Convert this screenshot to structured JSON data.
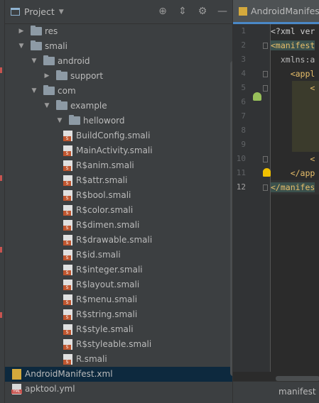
{
  "project_panel": {
    "title": "Project",
    "header_icons": [
      "crosshair-icon",
      "collapse-icon",
      "gear-icon",
      "minimize-icon"
    ],
    "tree": [
      {
        "label": "res",
        "type": "folder",
        "depth": 1,
        "expanded": false
      },
      {
        "label": "smali",
        "type": "folder",
        "depth": 1,
        "expanded": true
      },
      {
        "label": "android",
        "type": "folder",
        "depth": 2,
        "expanded": true
      },
      {
        "label": "support",
        "type": "folder",
        "depth": 3,
        "expanded": false
      },
      {
        "label": "com",
        "type": "folder",
        "depth": 2,
        "expanded": true
      },
      {
        "label": "example",
        "type": "folder",
        "depth": 3,
        "expanded": true
      },
      {
        "label": "helloword",
        "type": "folder",
        "depth": 4,
        "expanded": true
      },
      {
        "label": "BuildConfig.smali",
        "type": "smali",
        "depth": 5
      },
      {
        "label": "MainActivity.smali",
        "type": "smali",
        "depth": 5
      },
      {
        "label": "R$anim.smali",
        "type": "smali",
        "depth": 5
      },
      {
        "label": "R$attr.smali",
        "type": "smali",
        "depth": 5
      },
      {
        "label": "R$bool.smali",
        "type": "smali",
        "depth": 5
      },
      {
        "label": "R$color.smali",
        "type": "smali",
        "depth": 5
      },
      {
        "label": "R$dimen.smali",
        "type": "smali",
        "depth": 5
      },
      {
        "label": "R$drawable.smali",
        "type": "smali",
        "depth": 5
      },
      {
        "label": "R$id.smali",
        "type": "smali",
        "depth": 5
      },
      {
        "label": "R$integer.smali",
        "type": "smali",
        "depth": 5
      },
      {
        "label": "R$layout.smali",
        "type": "smali",
        "depth": 5
      },
      {
        "label": "R$menu.smali",
        "type": "smali",
        "depth": 5
      },
      {
        "label": "R$string.smali",
        "type": "smali",
        "depth": 5
      },
      {
        "label": "R$style.smali",
        "type": "smali",
        "depth": 5
      },
      {
        "label": "R$styleable.smali",
        "type": "smali",
        "depth": 5
      },
      {
        "label": "R.smali",
        "type": "smali",
        "depth": 5
      },
      {
        "label": "AndroidManifest.xml",
        "type": "xml",
        "depth": 1,
        "selected": true
      },
      {
        "label": "apktool.yml",
        "type": "yml",
        "depth": 1
      }
    ]
  },
  "editor": {
    "tab_label": "AndroidManifest.xml",
    "line_numbers": [
      "1",
      "2",
      "3",
      "4",
      "5",
      "6",
      "7",
      "8",
      "9",
      "10",
      "11",
      "12"
    ],
    "lines": [
      {
        "segments": [
          {
            "t": "<?xml ver",
            "c": "decl"
          }
        ]
      },
      {
        "segments": [
          {
            "t": "<manifest",
            "c": "tag-bg"
          }
        ]
      },
      {
        "segments": [
          {
            "t": "  xmlns:a",
            "c": "attr"
          }
        ]
      },
      {
        "segments": [
          {
            "t": "    <appl",
            "c": "tag"
          }
        ]
      },
      {
        "segments": [
          {
            "t": "        <",
            "c": "tag"
          }
        ]
      },
      {
        "segments": []
      },
      {
        "segments": []
      },
      {
        "segments": []
      },
      {
        "segments": []
      },
      {
        "segments": [
          {
            "t": "        <",
            "c": "tag"
          }
        ]
      },
      {
        "segments": [
          {
            "t": "    </app",
            "c": "tag"
          }
        ]
      },
      {
        "segments": [
          {
            "t": "</manifes",
            "c": "tag-bg"
          }
        ]
      }
    ],
    "current_line": 12,
    "breadcrumb": "manifest"
  }
}
